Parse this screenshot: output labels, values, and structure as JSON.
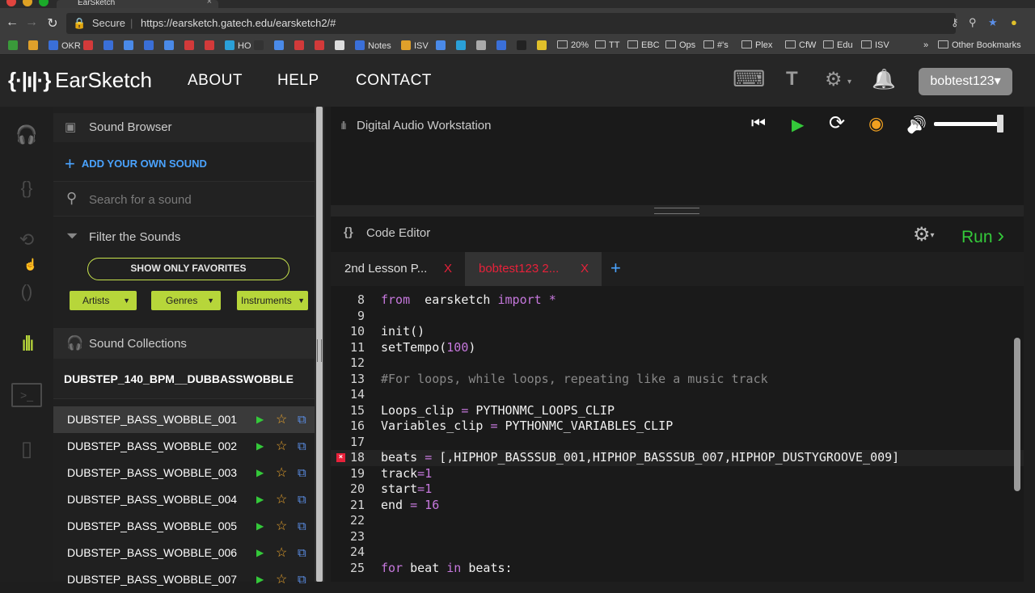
{
  "browser": {
    "tab_title": "EarSketch",
    "tab_close": "×",
    "nav": {
      "back": "←",
      "forward": "→",
      "reload": "↻"
    },
    "secure_label": "Secure",
    "url": "https://earsketch.gatech.edu/earsketch2/#",
    "bookmarks": [
      {
        "label": "",
        "color": "#3a9a3a",
        "type": "fav"
      },
      {
        "label": "",
        "color": "#e0a02a",
        "type": "fav"
      },
      {
        "label": "OKR",
        "color": "#3a6fd8",
        "type": "fav"
      },
      {
        "label": "",
        "color": "#d33a3a",
        "type": "fav"
      },
      {
        "label": "",
        "color": "#3a6fd8",
        "type": "fav"
      },
      {
        "label": "",
        "color": "#4a8ae8",
        "type": "fav"
      },
      {
        "label": "",
        "color": "#3a6fd8",
        "type": "fav"
      },
      {
        "label": "",
        "color": "#4a8ae8",
        "type": "fav"
      },
      {
        "label": "",
        "color": "#d33a3a",
        "type": "fav"
      },
      {
        "label": "",
        "color": "#d33a3a",
        "type": "fav"
      },
      {
        "label": "HO",
        "color": "#2aa0d8",
        "type": "fav"
      },
      {
        "label": "",
        "color": "#333",
        "type": "fav"
      },
      {
        "label": "",
        "color": "#4a8ae8",
        "type": "fav"
      },
      {
        "label": "",
        "color": "#d33a3a",
        "type": "fav"
      },
      {
        "label": "",
        "color": "#d33a3a",
        "type": "fav"
      },
      {
        "label": "",
        "color": "#ddd",
        "type": "fav"
      },
      {
        "label": "Notes",
        "color": "#3a6fd8",
        "type": "fav"
      },
      {
        "label": "ISV",
        "color": "#e0a02a",
        "type": "fav"
      },
      {
        "label": "",
        "color": "#4a8ae8",
        "type": "fav"
      },
      {
        "label": "",
        "color": "#2aa0d8",
        "type": "fav"
      },
      {
        "label": "",
        "color": "#aaa",
        "type": "fav"
      },
      {
        "label": "",
        "color": "#3a6fd8",
        "type": "fav"
      },
      {
        "label": "",
        "color": "#222",
        "type": "fav"
      },
      {
        "label": "",
        "color": "#e0c02a",
        "type": "fav"
      },
      {
        "label": "20%",
        "type": "folder"
      },
      {
        "label": "TT",
        "type": "folder"
      },
      {
        "label": "EBC",
        "type": "folder"
      },
      {
        "label": "Ops",
        "type": "folder"
      },
      {
        "label": "#'s",
        "type": "folder"
      },
      {
        "label": "Plex",
        "type": "folder"
      },
      {
        "label": "CfW",
        "type": "folder"
      },
      {
        "label": "Edu",
        "type": "folder"
      },
      {
        "label": "ISV",
        "type": "folder"
      }
    ],
    "more": "»",
    "other_bookmarks": "Other Bookmarks"
  },
  "header": {
    "logo_mark": "{·|ı|·}",
    "logo_text": "EarSketch",
    "nav": [
      "ABOUT",
      "HELP",
      "CONTACT"
    ],
    "keyboard_icon": "⌨",
    "font_icon": "T",
    "settings_icon": "⚙",
    "bell_icon": "🔔",
    "user": "bobtest123",
    "user_caret": "▾"
  },
  "rail": {
    "icons": [
      "headphones-folder-icon",
      "scripts-folder-icon",
      "shared-folder-icon",
      "api-folder-icon",
      "waveform-icon",
      "console-icon",
      "curriculum-icon"
    ]
  },
  "sound_browser": {
    "title": "Sound Browser",
    "add_sound": "ADD YOUR OWN SOUND",
    "search_placeholder": "Search for a sound",
    "filter_label": "Filter the Sounds",
    "favorites_button": "SHOW ONLY FAVORITES",
    "filters": [
      "Artists",
      "Genres",
      "Instruments"
    ],
    "collections_label": "Sound Collections",
    "folder": "DUBSTEP_140_BPM__DUBBASSWOBBLE",
    "sounds": [
      "DUBSTEP_BASS_WOBBLE_001",
      "DUBSTEP_BASS_WOBBLE_002",
      "DUBSTEP_BASS_WOBBLE_003",
      "DUBSTEP_BASS_WOBBLE_004",
      "DUBSTEP_BASS_WOBBLE_005",
      "DUBSTEP_BASS_WOBBLE_006",
      "DUBSTEP_BASS_WOBBLE_007"
    ],
    "selected_index": 0
  },
  "daw": {
    "title": "Digital Audio Workstation",
    "controls": {
      "rewind": "⏮",
      "play": "▶",
      "loop": "⟳",
      "metronome": "◉",
      "volume": "🔊"
    },
    "volume_level": 0.95
  },
  "code_editor": {
    "title": "Code Editor",
    "icon": "{}",
    "run_label": "Run",
    "run_chevron": "›",
    "tabs": [
      {
        "label": "2nd Lesson P...",
        "close": "X",
        "active": false
      },
      {
        "label": "bobtest123 2...",
        "close": "X",
        "active": true
      }
    ],
    "new_tab": "+",
    "lines": [
      {
        "n": "8",
        "segments": [
          [
            "kw",
            "from"
          ],
          [
            "",
            "  earsketch "
          ],
          [
            "kw",
            "import"
          ],
          [
            "op",
            " *"
          ]
        ]
      },
      {
        "n": "9",
        "segments": []
      },
      {
        "n": "10",
        "segments": [
          [
            "",
            "init()"
          ]
        ]
      },
      {
        "n": "11",
        "segments": [
          [
            "",
            "setTempo("
          ],
          [
            "num",
            "100"
          ],
          [
            "",
            ")"
          ]
        ]
      },
      {
        "n": "12",
        "segments": []
      },
      {
        "n": "13",
        "segments": [
          [
            "cmt",
            "#For loops, while loops, repeating like a music track"
          ]
        ]
      },
      {
        "n": "14",
        "segments": []
      },
      {
        "n": "15",
        "segments": [
          [
            "",
            "Loops_clip "
          ],
          [
            "op",
            "="
          ],
          [
            "",
            " PYTHONMC_LOOPS_CLIP"
          ]
        ]
      },
      {
        "n": "16",
        "segments": [
          [
            "",
            "Variables_clip "
          ],
          [
            "op",
            "="
          ],
          [
            "",
            " PYTHONMC_VARIABLES_CLIP"
          ]
        ]
      },
      {
        "n": "17",
        "segments": []
      },
      {
        "n": "18",
        "error": true,
        "segments": [
          [
            "",
            "beats "
          ],
          [
            "op",
            "="
          ],
          [
            "",
            " [,HIPHOP_BASSSUB_001,HIPHOP_BASSSUB_007,HIPHOP_DUSTYGROOVE_009]"
          ]
        ]
      },
      {
        "n": "19",
        "segments": [
          [
            "",
            "track"
          ],
          [
            "op",
            "="
          ],
          [
            "num",
            "1"
          ]
        ]
      },
      {
        "n": "20",
        "segments": [
          [
            "",
            "start"
          ],
          [
            "op",
            "="
          ],
          [
            "num",
            "1"
          ]
        ]
      },
      {
        "n": "21",
        "segments": [
          [
            "",
            "end "
          ],
          [
            "op",
            "="
          ],
          [
            "num",
            " 16"
          ]
        ]
      },
      {
        "n": "22",
        "segments": []
      },
      {
        "n": "23",
        "segments": []
      },
      {
        "n": "24",
        "segments": []
      },
      {
        "n": "25",
        "segments": [
          [
            "kw",
            "for"
          ],
          [
            "",
            " beat "
          ],
          [
            "kw",
            "in"
          ],
          [
            "",
            " beats:"
          ]
        ]
      }
    ]
  }
}
